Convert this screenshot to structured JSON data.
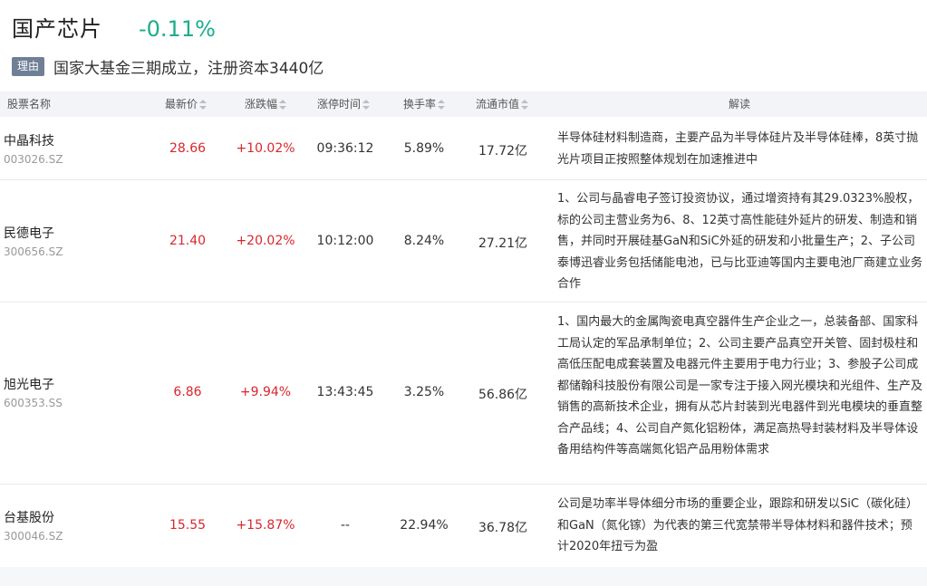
{
  "sector": {
    "title": "国产芯片",
    "change": "-0.11%"
  },
  "reason": {
    "badge": "理由",
    "text": "国家大基金三期成立，注册资本3440亿"
  },
  "columns": {
    "name": "股票名称",
    "price": "最新价",
    "change": "涨跌幅",
    "limit_time": "涨停时间",
    "turnover": "换手率",
    "market_cap": "流通市值",
    "note": "解读"
  },
  "rows": [
    {
      "name": "中晶科技",
      "code": "003026.SZ",
      "price": "28.66",
      "change": "+10.02%",
      "limit_time": "09:36:12",
      "turnover": "5.89%",
      "market_cap": "17.72亿",
      "note": "半导体硅材料制造商，主要产品为半导体硅片及半导体硅棒，8英寸抛光片项目正按照整体规划在加速推进中"
    },
    {
      "name": "民德电子",
      "code": "300656.SZ",
      "price": "21.40",
      "change": "+20.02%",
      "limit_time": "10:12:00",
      "turnover": "8.24%",
      "market_cap": "27.21亿",
      "note": "1、公司与晶睿电子签订投资协议，通过增资持有其29.0323%股权，标的公司主营业务为6、8、12英寸高性能硅外延片的研发、制造和销售，并同时开展硅基GaN和SiC外延的研发和小批量生产；2、子公司泰博迅睿业务包括储能电池，已与比亚迪等国内主要电池厂商建立业务合作"
    },
    {
      "name": "旭光电子",
      "code": "600353.SS",
      "price": "6.86",
      "change": "+9.94%",
      "limit_time": "13:43:45",
      "turnover": "3.25%",
      "market_cap": "56.86亿",
      "note": "1、国内最大的金属陶瓷电真空器件生产企业之一，总装备部、国家科工局认定的军品承制单位；2、公司主要产品真空开关管、固封极柱和高低压配电成套装置及电器元件主要用于电力行业；3、参股子公司成都储翰科技股份有限公司是一家专注于接入网光模块和光组件、生产及销售的高新技术企业，拥有从芯片封装到光电器件到光电模块的垂直整合产品线；4、公司自产氮化铝粉体，满足高热导封装材料及半导体设备用结构件等高端氮化铝产品用粉体需求"
    },
    {
      "name": "台基股份",
      "code": "300046.SZ",
      "price": "15.55",
      "change": "+15.87%",
      "limit_time": "--",
      "turnover": "22.94%",
      "market_cap": "36.78亿",
      "note": "公司是功率半导体细分市场的重要企业，跟踪和研发以SiC（碳化硅）和GaN（氮化镓）为代表的第三代宽禁带半导体材料和器件技术；预计2020年扭亏为盈"
    }
  ]
}
